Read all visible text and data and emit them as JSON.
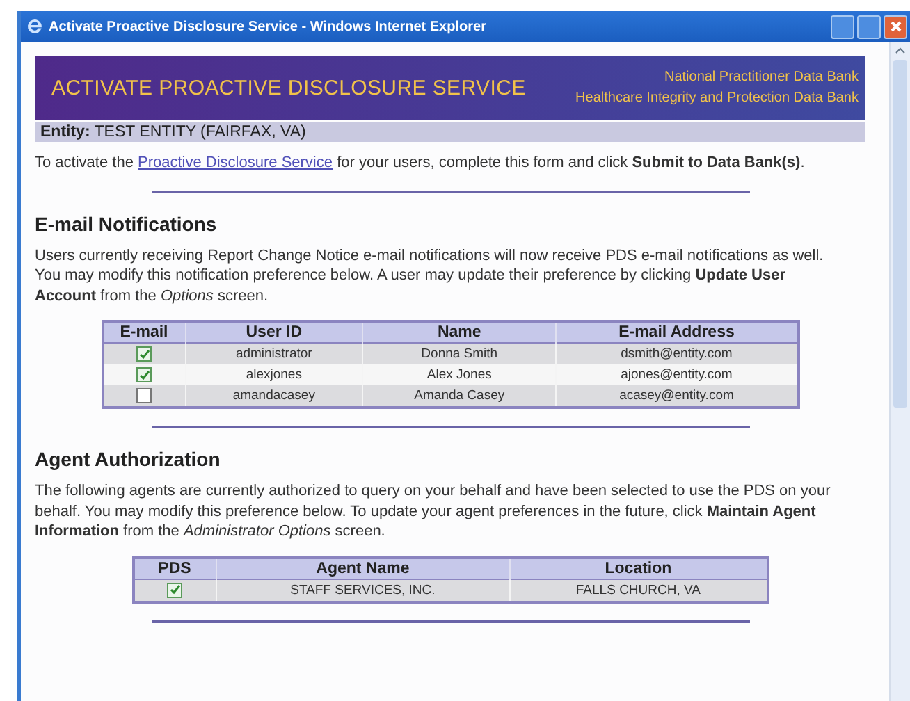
{
  "window": {
    "title": "Activate Proactive Disclosure Service - Windows Internet Explorer"
  },
  "banner": {
    "title": "ACTIVATE PROACTIVE DISCLOSURE SERVICE",
    "org_lines": [
      "National Practitioner Data Bank",
      "Healthcare Integrity and Protection Data Bank"
    ]
  },
  "entity": {
    "label": "Entity:",
    "value": "TEST ENTITY (FAIRFAX, VA)"
  },
  "intro": {
    "before": "To activate the",
    "link": "Proactive Disclosure Service",
    "after": "for your users, complete this form and click **Submit to Data Bank(s)**."
  },
  "sections": [
    {
      "heading": "E-mail Notifications",
      "text": "Users currently receiving Report Change Notice e-mail notifications will now receive PDS e-mail notifications as well. You may modify this notification preference below. A user may update their preference by clicking **Update User Account** from the *Options* screen.",
      "columns": [
        "E-mail",
        "User ID",
        "Name",
        "E-mail Address"
      ],
      "rows": [
        {
          "checked": true,
          "cells": [
            "",
            "administrator",
            "Donna Smith",
            "dsmith@entity.com"
          ]
        },
        {
          "checked": true,
          "cells": [
            "",
            "alexjones",
            "Alex Jones",
            "ajones@entity.com"
          ]
        },
        {
          "checked": false,
          "cells": [
            "",
            "amandacasey",
            "Amanda Casey",
            "acasey@entity.com"
          ]
        }
      ]
    },
    {
      "heading": "Agent Authorization",
      "text": "The following agents are currently authorized to query on your behalf and have been selected to use the PDS on your behalf. You may modify this preference below. To update your agent preferences in the future, click **Maintain Agent Information** from the *Administrator Options* screen.",
      "columns": [
        "PDS",
        "Agent Name",
        "Location"
      ],
      "rows": [
        {
          "checked": true,
          "cells": [
            "",
            "STAFF SERVICES, INC.",
            "FALLS CHURCH, VA"
          ]
        }
      ]
    }
  ]
}
